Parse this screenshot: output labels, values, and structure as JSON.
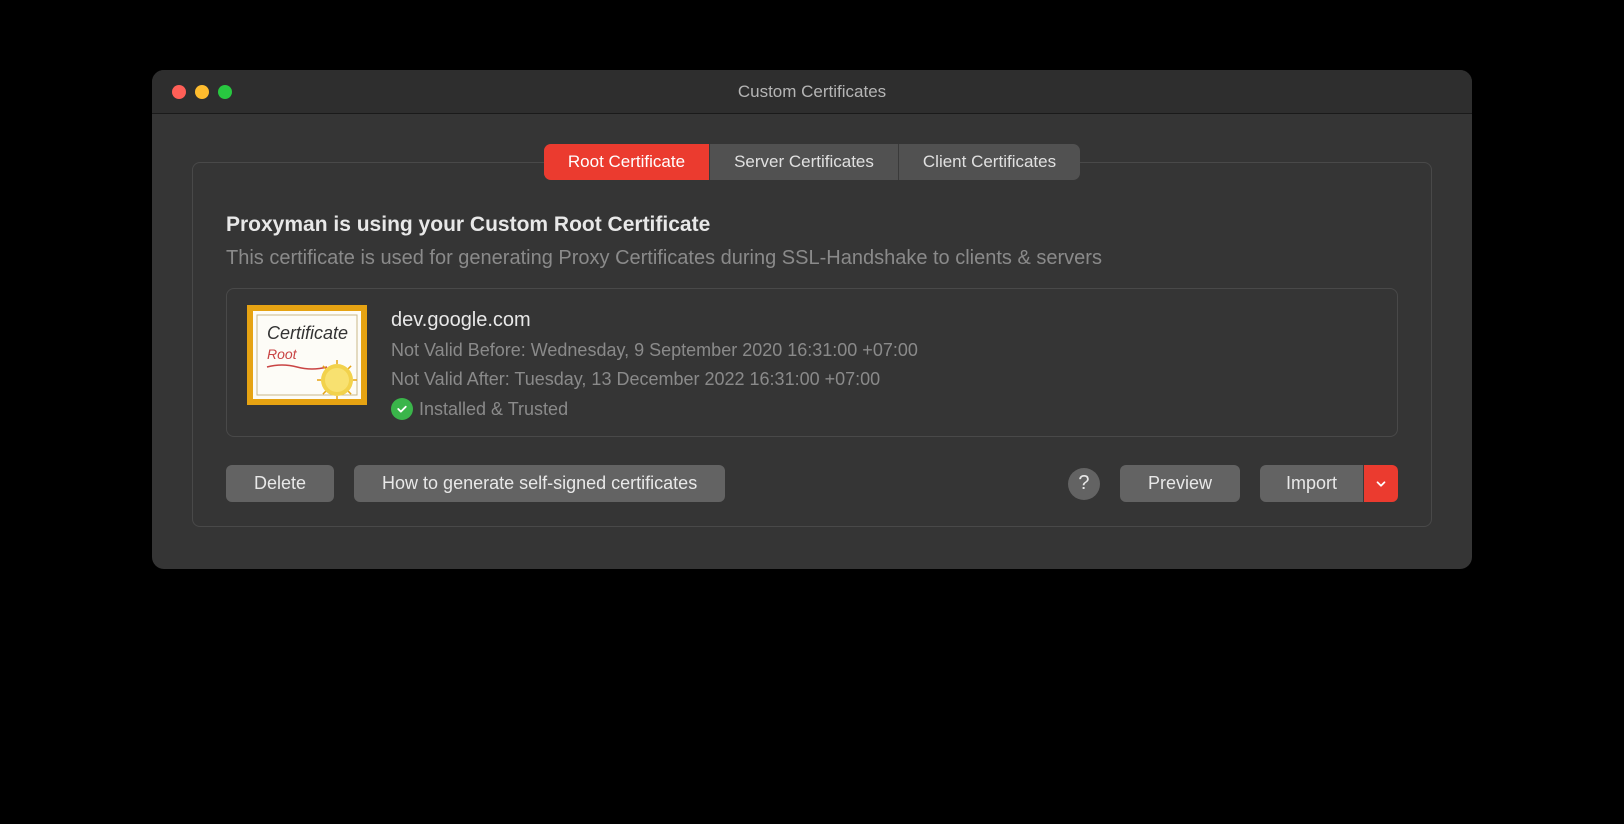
{
  "window": {
    "title": "Custom Certificates"
  },
  "tabs": [
    {
      "label": "Root Certificate",
      "active": true
    },
    {
      "label": "Server Certificates",
      "active": false
    },
    {
      "label": "Client Certificates",
      "active": false
    }
  ],
  "content": {
    "heading": "Proxyman is using your Custom Root Certificate",
    "subheading": "This certificate is used for generating Proxy Certificates during SSL-Handshake to clients & servers",
    "certificate": {
      "name": "dev.google.com",
      "not_valid_before": "Not Valid Before: Wednesday, 9 September 2020 16:31:00 +07:00",
      "not_valid_after": "Not Valid After: Tuesday, 13 December 2022 16:31:00 +07:00",
      "status": "Installed & Trusted"
    }
  },
  "buttons": {
    "delete": "Delete",
    "howto": "How to generate self-signed certificates",
    "help": "?",
    "preview": "Preview",
    "import": "Import"
  }
}
